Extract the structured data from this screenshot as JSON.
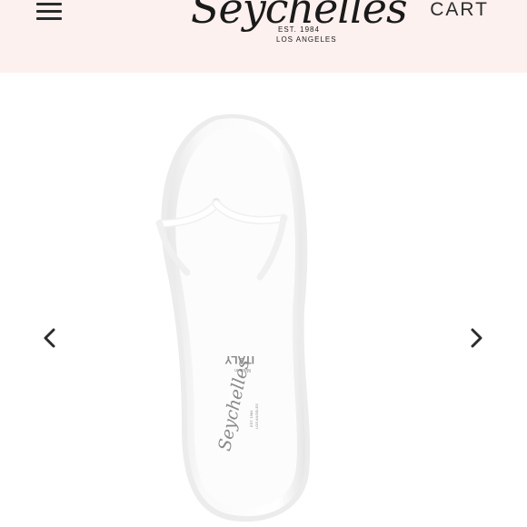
{
  "header": {
    "logo": {
      "script_text": "Seychelles",
      "est_text": "EST. 1984",
      "city_text": "LOS ANGELES"
    },
    "cart_label": "CART",
    "menu_icon": "hamburger-menu-icon"
  },
  "gallery": {
    "prev_icon": "chevron-left-icon",
    "next_icon": "chevron-right-icon",
    "insole": {
      "made_in_small": "Made in",
      "made_in_country": "ITALY",
      "brand_script": "Seychelles",
      "brand_est": "EST. 1984",
      "brand_city": "LOS ANGELES"
    }
  },
  "colors": {
    "header_bg": "#fdf1ef",
    "text_dark": "#2b2b2b",
    "sandal": "#ffffff"
  }
}
